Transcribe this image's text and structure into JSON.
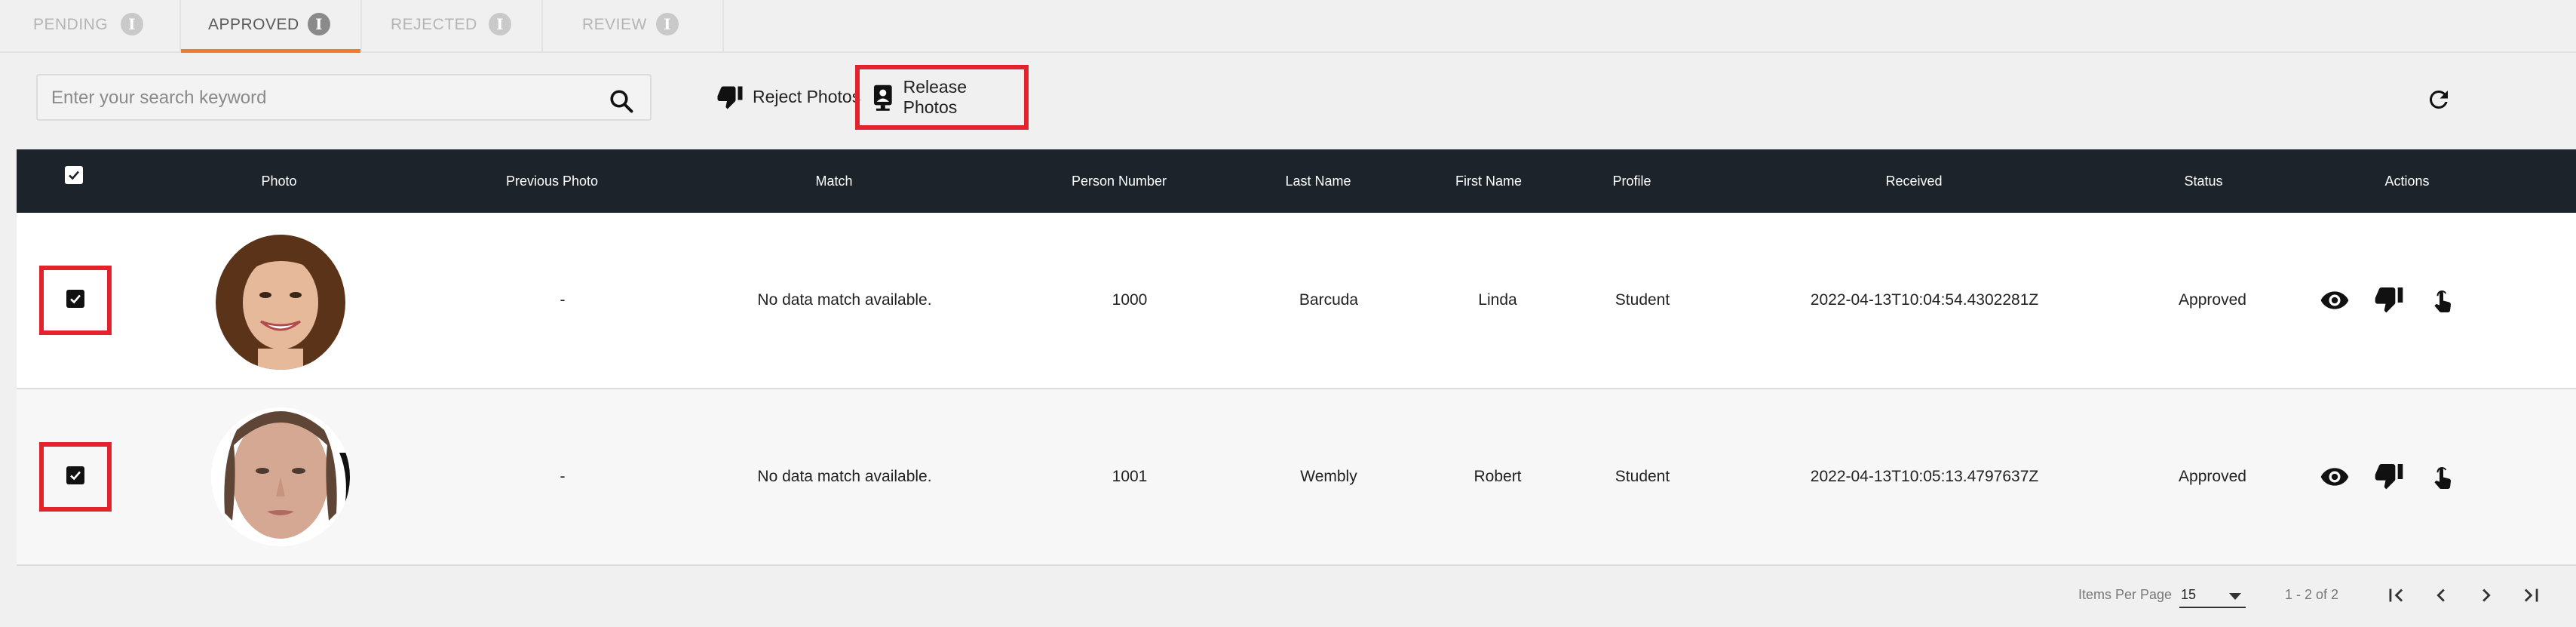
{
  "tabs": [
    {
      "label": "PENDING",
      "active": false
    },
    {
      "label": "APPROVED",
      "active": true
    },
    {
      "label": "REJECTED",
      "active": false
    },
    {
      "label": "REVIEW",
      "active": false
    }
  ],
  "tab_info_glyph": "i",
  "search": {
    "placeholder": "Enter your search keyword",
    "value": ""
  },
  "toolbar": {
    "reject_label": "Reject Photos",
    "release_label": "Release Photos"
  },
  "table": {
    "columns": [
      "Photo",
      "Previous Photo",
      "Match",
      "Person Number",
      "Last Name",
      "First Name",
      "Profile",
      "Received",
      "Status",
      "Actions"
    ],
    "rows": [
      {
        "checked": true,
        "previous_photo": "-",
        "match": "No data match available.",
        "person_number": "1000",
        "last_name": "Barcuda",
        "first_name": "Linda",
        "profile": "Student",
        "received": "2022-04-13T10:04:54.4302281Z",
        "status": "Approved"
      },
      {
        "checked": true,
        "previous_photo": "-",
        "match": "No data match available.",
        "person_number": "1001",
        "last_name": "Wembly",
        "first_name": "Robert",
        "profile": "Student",
        "received": "2022-04-13T10:05:13.4797637Z",
        "status": "Approved"
      }
    ]
  },
  "pagination": {
    "items_per_page_label": "Items Per Page",
    "items_per_page": "15",
    "range": "1 - 2 of 2"
  },
  "colors": {
    "accent": "#f07c2a",
    "highlight": "#e3232b",
    "header_bg": "#1d232b"
  },
  "icons": [
    "info-icon",
    "search-icon",
    "thumbs-down-icon",
    "release-photo-icon",
    "refresh-icon",
    "eye-icon",
    "hand-pointer-icon",
    "first-page-icon",
    "prev-page-icon",
    "next-page-icon",
    "last-page-icon"
  ]
}
